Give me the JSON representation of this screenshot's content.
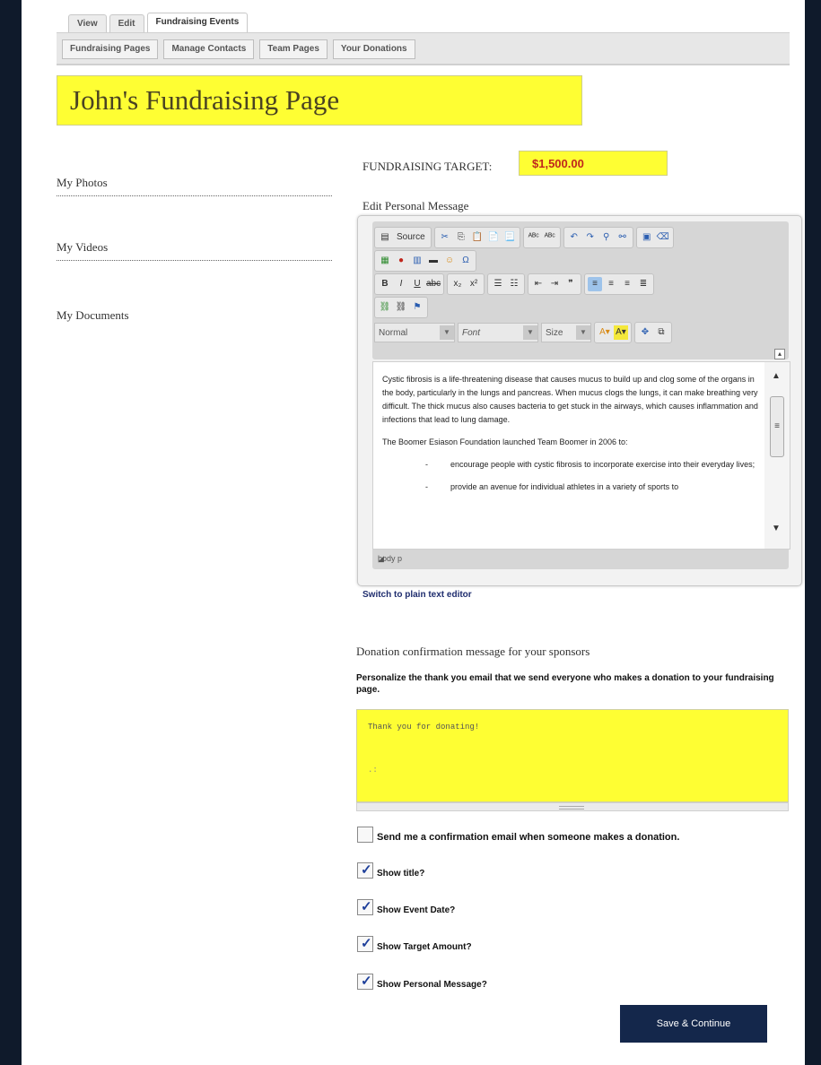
{
  "tabs": [
    {
      "label": "View"
    },
    {
      "label": "Edit"
    },
    {
      "label": "Fundraising Events"
    }
  ],
  "subtabs": [
    {
      "label": "Fundraising Pages"
    },
    {
      "label": "Manage Contacts"
    },
    {
      "label": "Team Pages"
    },
    {
      "label": "Your Donations"
    }
  ],
  "page_title": "John's Fundraising Page",
  "sidebar": {
    "items": [
      {
        "label": "My Photos"
      },
      {
        "label": "My Videos"
      },
      {
        "label": "My Documents"
      }
    ]
  },
  "target": {
    "label": "FUNDRAISING TARGET:",
    "value": "$1,500.00"
  },
  "editor": {
    "label": "Edit Personal Message",
    "source_label": "Source",
    "format_select": "Normal",
    "font_select": "Font",
    "size_select": "Size",
    "body_paragraphs": [
      "Cystic fibrosis is a life-threatening disease that causes mucus to build up and clog some of the organs in the body, particularly in the lungs and pancreas. When mucus clogs the lungs, it can make breathing very difficult. The thick mucus also causes bacteria to get stuck in the airways, which causes inflammation and infections that lead to lung damage.",
      "The Boomer Esiason Foundation launched Team Boomer in 2006 to:"
    ],
    "bullets": [
      "encourage people with cystic fibrosis to incorporate exercise into their everyday lives;",
      "provide an avenue for individual athletes in a variety of sports to"
    ],
    "status_path": "body p",
    "switch_link": "Switch to plain text editor"
  },
  "donation": {
    "title": "Donation confirmation message for your sponsors",
    "description": "Personalize the thank you email that we send everyone who makes a donation to your fundraising page.",
    "message": "Thank you for donating!"
  },
  "checkboxes": [
    {
      "label": "Send me a confirmation email when someone makes a donation.",
      "checked": false
    },
    {
      "label": "Show title?",
      "checked": true
    },
    {
      "label": "Show Event Date?",
      "checked": true
    },
    {
      "label": "Show Target Amount?",
      "checked": true
    },
    {
      "label": "Show Personal Message?",
      "checked": true
    }
  ],
  "save_button": "Save & Continue"
}
